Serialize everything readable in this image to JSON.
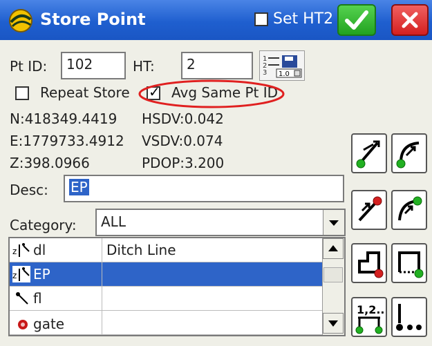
{
  "window": {
    "title": "Store Point"
  },
  "title_actions": {
    "set_ht2_label": "Set HT2",
    "set_ht2_checked": false,
    "ok_icon": "check-icon",
    "close_icon": "close-icon"
  },
  "form": {
    "pt_id_label": "Pt ID:",
    "pt_id_value": "102",
    "ht_label": "HT:",
    "ht_value": "2",
    "repeat_store_label": "Repeat Store",
    "repeat_store_checked": false,
    "avg_same_label": "Avg Same Pt ID",
    "avg_same_checked": true
  },
  "readouts": {
    "n": "N:418349.4419",
    "e": "E:1779733.4912",
    "z": "Z:398.0966",
    "hsdv": "HSDV:0.042",
    "vsdv": "VSDV:0.074",
    "pdop": "PDOP:3.200"
  },
  "desc": {
    "label": "Desc:",
    "value": "EP"
  },
  "category": {
    "label": "Category:",
    "value": "ALL"
  },
  "codes_table": {
    "rows": [
      {
        "code": "dl",
        "description": "Ditch Line",
        "icon": "ditch-line-icon"
      },
      {
        "code": "EP",
        "description": "",
        "icon": "edge-pavement-icon",
        "selected": true
      },
      {
        "code": "fl",
        "description": "",
        "icon": "flow-line-icon"
      },
      {
        "code": "gate",
        "description": "",
        "icon": "gate-icon"
      }
    ]
  },
  "tool_buttons": [
    {
      "name": "start-line-icon"
    },
    {
      "name": "start-curve-icon"
    },
    {
      "name": "end-line-icon"
    },
    {
      "name": "end-curve-icon"
    },
    {
      "name": "close-polygon-icon"
    },
    {
      "name": "rectangle-icon"
    },
    {
      "name": "sequence-points-icon"
    },
    {
      "name": "more-icon"
    }
  ],
  "colors": {
    "title_bar": "#1f5fcf",
    "selection": "#2e64c8",
    "annotation_ellipse": "#e02020",
    "ok": "#22a220",
    "close": "#d42020"
  }
}
